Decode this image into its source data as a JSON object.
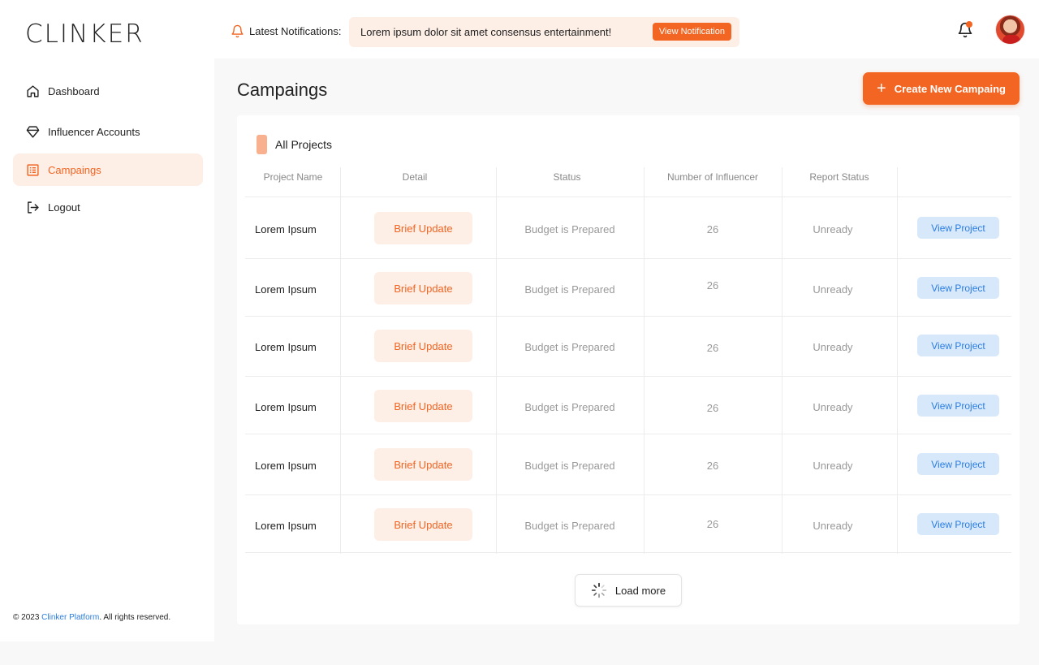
{
  "brand": {
    "logo": "CLINKER"
  },
  "notifications": {
    "label": "Latest Notifications:",
    "message": "Lorem ipsum dolor sit amet consensus entertainment!",
    "button_label": "View Notification"
  },
  "sidebar": {
    "items": [
      {
        "label": "Dashboard",
        "icon": "home-icon",
        "active": false
      },
      {
        "label": "Influencer Accounts",
        "icon": "diamond-icon",
        "active": false
      },
      {
        "label": "Campaings",
        "icon": "list-icon",
        "active": true
      },
      {
        "label": "Logout",
        "icon": "logout-icon",
        "active": false
      }
    ],
    "footer": {
      "prefix": "© 2023 ",
      "brand": "Clinker Platform",
      "suffix": ". All rights reserved."
    }
  },
  "main": {
    "title": "Campaings",
    "create_button_label": "Create New Campaing",
    "panel_tag": "All Projects",
    "columns": [
      "Project Name",
      "Detail",
      "Status",
      "Number of Influencer",
      "Report Status",
      ""
    ],
    "rows": [
      {
        "name": "Lorem Ipsum",
        "detail": "Brief Update",
        "status": "Budget is Prepared",
        "count": "26",
        "report": "Unready",
        "action": "View Project"
      },
      {
        "name": "Lorem Ipsum",
        "detail": "Brief Update",
        "status": "Budget is Prepared",
        "count": "26",
        "report": "Unready",
        "action": "View Project"
      },
      {
        "name": "Lorem Ipsum",
        "detail": "Brief Update",
        "status": "Budget is Prepared",
        "count": "26",
        "report": "Unready",
        "action": "View Project"
      },
      {
        "name": "Lorem Ipsum",
        "detail": "Brief Update",
        "status": "Budget is Prepared",
        "count": "26",
        "report": "Unready",
        "action": "View Project"
      },
      {
        "name": "Lorem Ipsum",
        "detail": "Brief Update",
        "status": "Budget is Prepared",
        "count": "26",
        "report": "Unready",
        "action": "View Project"
      },
      {
        "name": "Lorem Ipsum",
        "detail": "Brief Update",
        "status": "Budget is Prepared",
        "count": "26",
        "report": "Unready",
        "action": "View Project"
      }
    ],
    "load_more_label": "Load more"
  },
  "colors": {
    "accent": "#f26522",
    "accent_soft": "#fdeee6",
    "link": "#2a7de1",
    "link_soft": "#d7e8fb"
  }
}
